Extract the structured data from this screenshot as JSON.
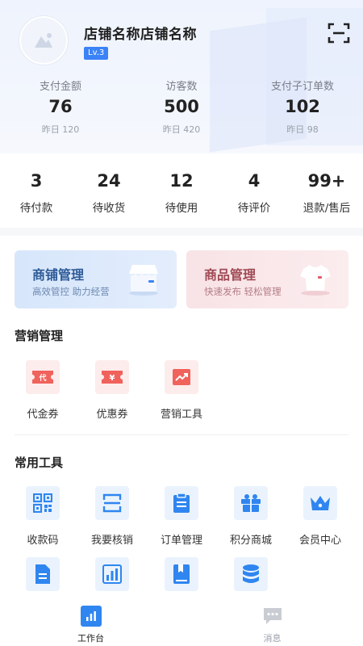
{
  "header": {
    "shop_name": "店铺名称店铺名称",
    "level": "Lv.3",
    "avatar_icon": "image-placeholder-icon",
    "scan_icon": "scan-icon"
  },
  "stats": [
    {
      "label": "支付金额",
      "value": "76",
      "yesterday": "昨日 120"
    },
    {
      "label": "访客数",
      "value": "500",
      "yesterday": "昨日 420"
    },
    {
      "label": "支付子订单数",
      "value": "102",
      "yesterday": "昨日 98"
    }
  ],
  "orders": [
    {
      "count": "3",
      "label": "待付款"
    },
    {
      "count": "24",
      "label": "待收货"
    },
    {
      "count": "12",
      "label": "待使用"
    },
    {
      "count": "4",
      "label": "待评价"
    },
    {
      "count": "99+",
      "label": "退款/售后"
    }
  ],
  "cards": {
    "shop": {
      "title": "商铺管理",
      "subtitle": "高效管控 助力经营",
      "icon": "store-icon"
    },
    "goods": {
      "title": "商品管理",
      "subtitle": "快速发布 轻松管理",
      "icon": "shirt-icon"
    }
  },
  "marketing": {
    "title": "营销管理",
    "items": [
      {
        "label": "代金券",
        "icon": "voucher-icon",
        "glyph": "代"
      },
      {
        "label": "优惠券",
        "icon": "coupon-icon",
        "glyph": "¥"
      },
      {
        "label": "营销工具",
        "icon": "trend-chart-icon"
      }
    ]
  },
  "tools": {
    "title": "常用工具",
    "items": [
      {
        "label": "收款码",
        "icon": "qr-code-icon"
      },
      {
        "label": "我要核销",
        "icon": "scan-verify-icon"
      },
      {
        "label": "订单管理",
        "icon": "clipboard-icon"
      },
      {
        "label": "积分商城",
        "icon": "gift-box-icon"
      },
      {
        "label": "会员中心",
        "icon": "crown-icon"
      }
    ]
  },
  "tabbar": {
    "items": [
      {
        "label": "工作台",
        "icon": "workbench-icon",
        "active": true
      },
      {
        "label": "消息",
        "icon": "message-icon",
        "active": false
      }
    ]
  },
  "colors": {
    "accent": "#3a83f7",
    "marketing_icon": "#f0625c",
    "tool_icon": "#2f86f0"
  }
}
